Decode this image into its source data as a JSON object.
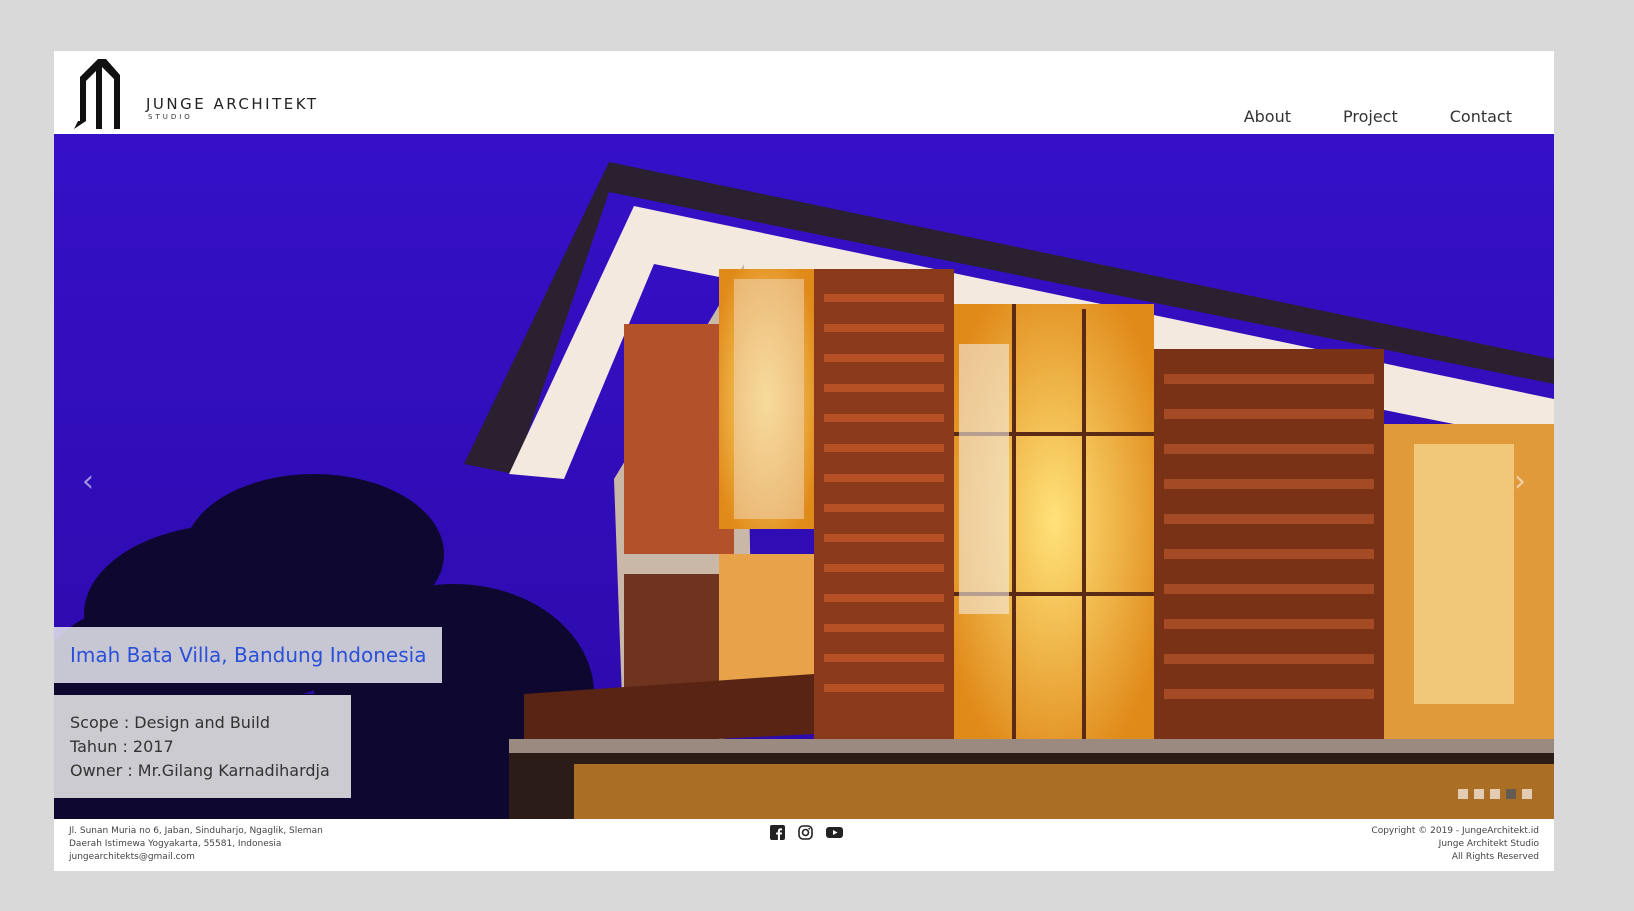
{
  "brand": {
    "name": "JUNGE ARCHITEKT",
    "sub": "STUDIO"
  },
  "nav": {
    "items": [
      "About",
      "Project",
      "Contact"
    ]
  },
  "carousel": {
    "prev_label": "‹",
    "next_label": "›",
    "title": "Imah Bata Villa, Bandung Indonesia",
    "info": [
      "Scope : Design and Build",
      "Tahun : 2017",
      "Owner : Mr.Gilang Karnadihardja"
    ],
    "slide_count": 5,
    "active_slide": 4
  },
  "footer": {
    "address": [
      "Jl. Sunan Muria no 6, Jaban, Sinduharjo, Ngaglik, Sleman",
      "Daerah Istimewa Yogyakarta, 55581, Indonesia",
      "jungearchitekts@gmail.com"
    ],
    "copyright": [
      "Copyright © 2019 - JungeArchitekt.id",
      "Junge Architekt Studio",
      "All Rights Reserved"
    ],
    "social": [
      "facebook-icon",
      "instagram-icon",
      "youtube-icon"
    ]
  },
  "colors": {
    "sky": "#3a0fc4",
    "caption_title": "#2a4fd9",
    "brick": "#8a3a1a",
    "window_glow": "#f5c542"
  }
}
